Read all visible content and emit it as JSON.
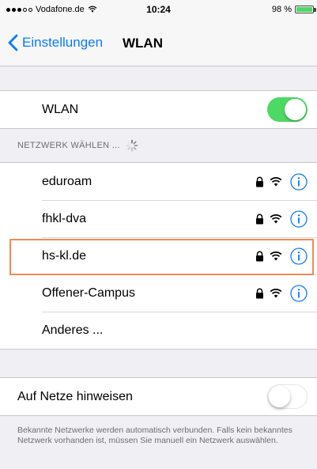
{
  "status_bar": {
    "carrier": "Vodafone.de",
    "time": "10:24",
    "battery_percent_label": "98 %",
    "battery_level": 0.98,
    "signal_dots_filled": 3,
    "signal_dots_total": 5
  },
  "nav": {
    "back_label": "Einstellungen",
    "title": "WLAN"
  },
  "wlan_toggle": {
    "label": "WLAN",
    "on": true
  },
  "network_section": {
    "header": "NETZWERK WÄHLEN ..."
  },
  "networks": [
    {
      "name": "eduroam",
      "secured": true,
      "highlighted": false
    },
    {
      "name": "fhkl-dva",
      "secured": true,
      "highlighted": false
    },
    {
      "name": "hs-kl.de",
      "secured": true,
      "highlighted": true
    },
    {
      "name": "Offener-Campus",
      "secured": true,
      "highlighted": false
    }
  ],
  "other_network_label": "Anderes ...",
  "ask_to_join": {
    "label": "Auf Netze hinweisen",
    "on": false
  },
  "footer_note": "Bekannte Netzwerke werden automatisch verbunden. Falls kein bekanntes Netzwerk vorhanden ist, müssen Sie manuell ein Netzwerk auswählen.",
  "colors": {
    "accent": "#0a7aff",
    "toggle_on": "#4cd964",
    "highlight_border": "#f08a52",
    "background": "#efeff4"
  }
}
